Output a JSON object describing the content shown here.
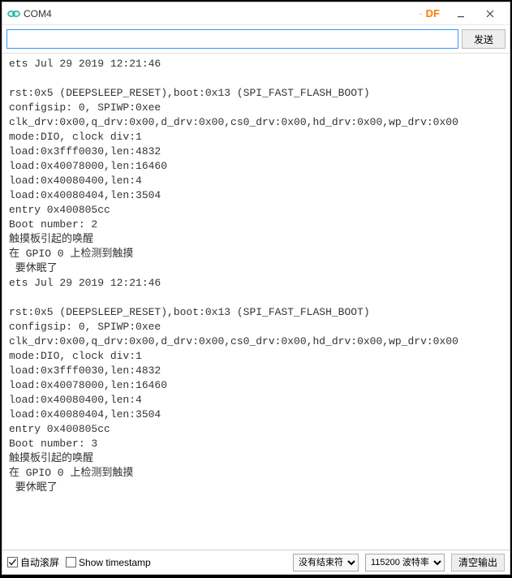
{
  "titlebar": {
    "title": "COM4",
    "df_dash": "-",
    "df_text": "DF"
  },
  "input_row": {
    "send_label": "发送",
    "input_value": ""
  },
  "console_lines": [
    "ets Jul 29 2019 12:21:46",
    "",
    "rst:0x5 (DEEPSLEEP_RESET),boot:0x13 (SPI_FAST_FLASH_BOOT)",
    "configsip: 0, SPIWP:0xee",
    "clk_drv:0x00,q_drv:0x00,d_drv:0x00,cs0_drv:0x00,hd_drv:0x00,wp_drv:0x00",
    "mode:DIO, clock div:1",
    "load:0x3fff0030,len:4832",
    "load:0x40078000,len:16460",
    "load:0x40080400,len:4",
    "load:0x40080404,len:3504",
    "entry 0x400805cc",
    "Boot number: 2",
    "触摸板引起的唤醒",
    "在 GPIO 0 上检测到触摸",
    " 要休眠了",
    "ets Jul 29 2019 12:21:46",
    "",
    "rst:0x5 (DEEPSLEEP_RESET),boot:0x13 (SPI_FAST_FLASH_BOOT)",
    "configsip: 0, SPIWP:0xee",
    "clk_drv:0x00,q_drv:0x00,d_drv:0x00,cs0_drv:0x00,hd_drv:0x00,wp_drv:0x00",
    "mode:DIO, clock div:1",
    "load:0x3fff0030,len:4832",
    "load:0x40078000,len:16460",
    "load:0x40080400,len:4",
    "load:0x40080404,len:3504",
    "entry 0x400805cc",
    "Boot number: 3",
    "触摸板引起的唤醒",
    "在 GPIO 0 上检测到触摸",
    " 要休眠了"
  ],
  "bottombar": {
    "autoscroll_label": "自动滚屏",
    "autoscroll_checked": true,
    "timestamp_label": "Show timestamp",
    "timestamp_checked": false,
    "line_ending_selected": "没有结束符",
    "baud_selected": "115200 波特率",
    "clear_label": "清空输出"
  }
}
